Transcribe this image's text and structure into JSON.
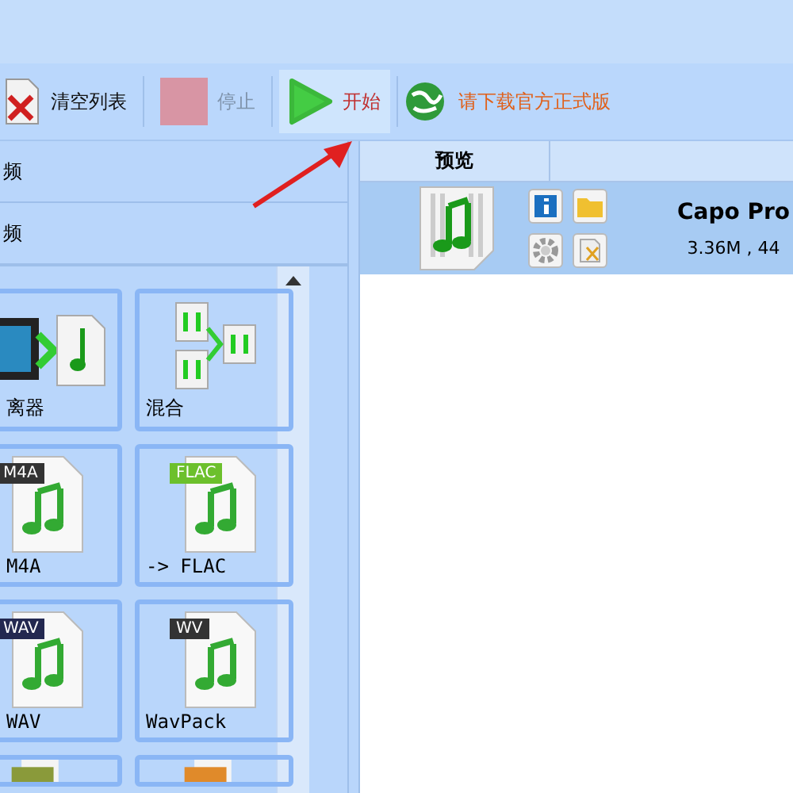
{
  "toolbar": {
    "buttons": [
      {
        "label": "清空列表",
        "kind": "clear",
        "disabled": false,
        "highlighted": false
      },
      {
        "label": "停止",
        "kind": "stop",
        "disabled": true,
        "highlighted": false
      },
      {
        "label": "开始",
        "kind": "start",
        "disabled": false,
        "highlighted": true
      }
    ],
    "link": "请下载官方正式版"
  },
  "left_panel": {
    "sections": [
      "频",
      "频"
    ],
    "tiles": [
      {
        "kind": "split",
        "label": "离器"
      },
      {
        "kind": "mix",
        "label": "混合"
      },
      {
        "kind": "doc",
        "badge": "M4A",
        "color": "#333333",
        "label": "M4A"
      },
      {
        "kind": "doc",
        "badge": "FLAC",
        "color": "#6cc02c",
        "label": "-> FLAC"
      },
      {
        "kind": "doc",
        "badge": "WAV",
        "color": "#232850",
        "label": "WAV"
      },
      {
        "kind": "doc",
        "badge": "WV",
        "color": "#333333",
        "label": "WavPack"
      },
      {
        "kind": "cut",
        "color": "#8a9a3a"
      },
      {
        "kind": "cut",
        "color": "#e08a2a"
      }
    ]
  },
  "file_list": {
    "columns": [
      "预览"
    ],
    "rows": [
      {
        "selected": true,
        "title": "Capo Pro",
        "info": "3.36M , 44"
      }
    ]
  }
}
